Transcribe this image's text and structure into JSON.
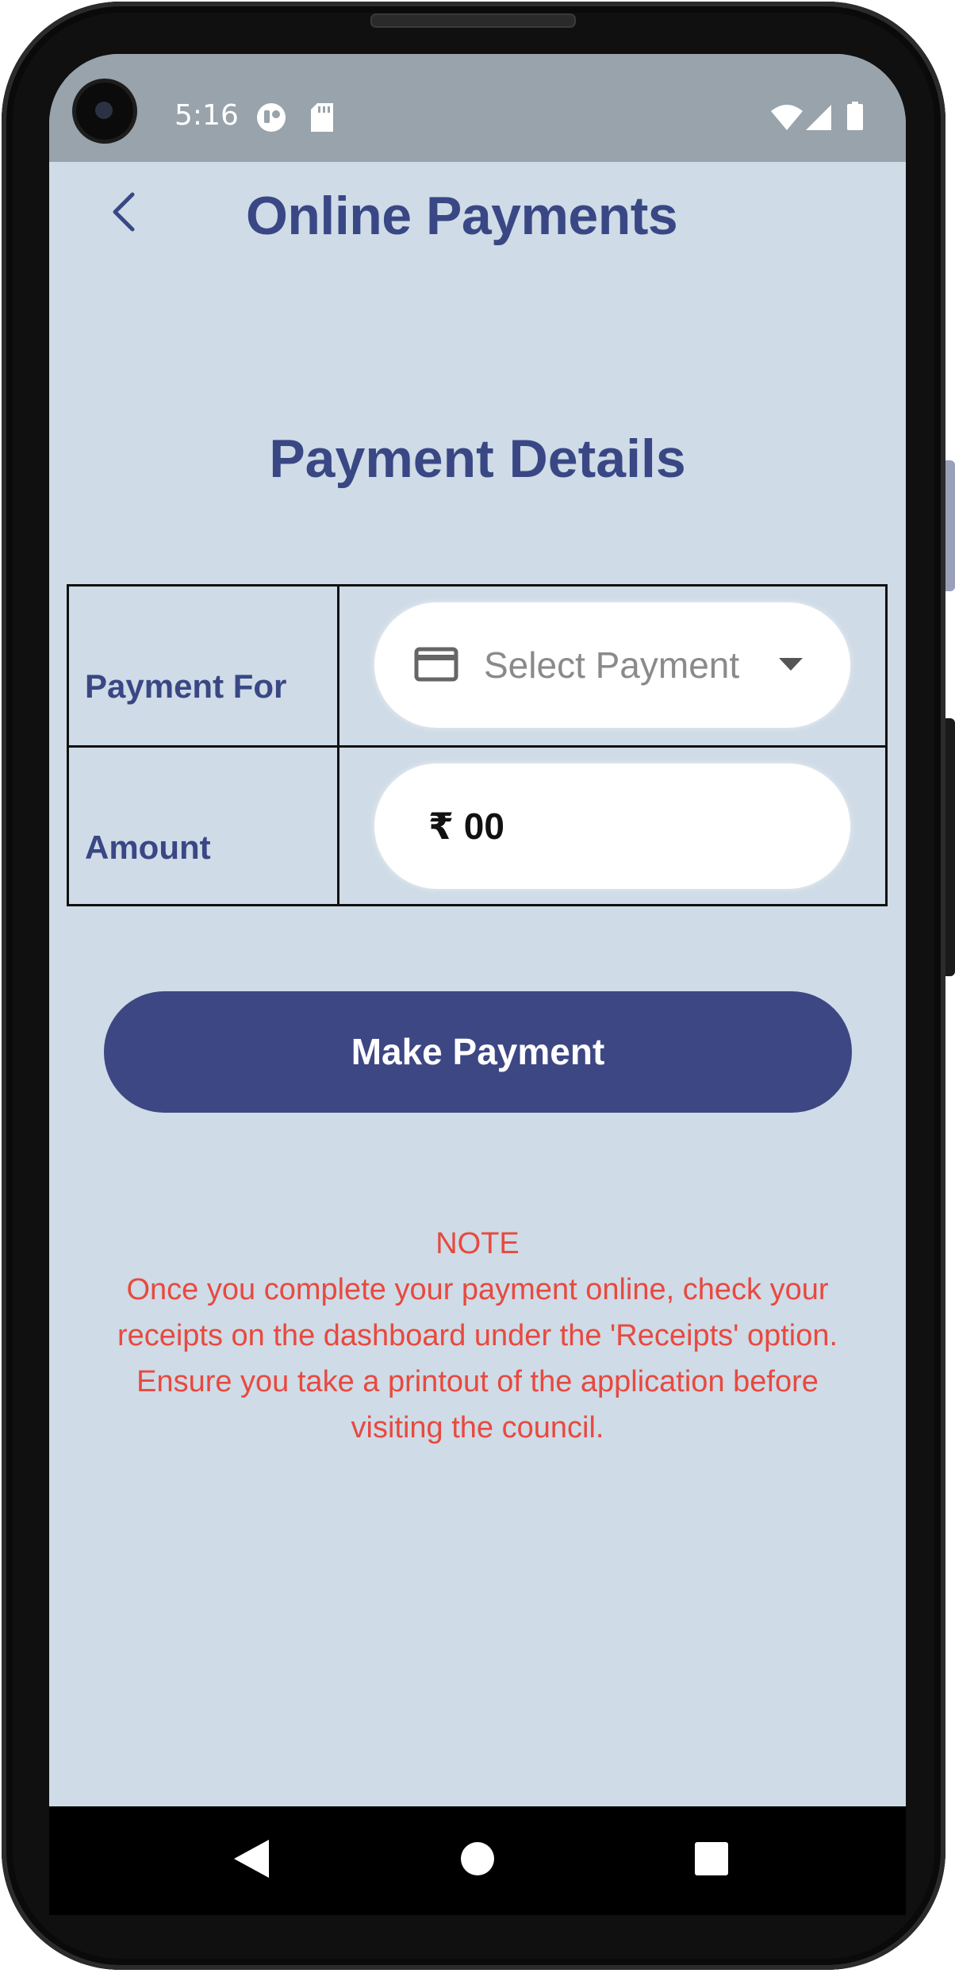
{
  "status_bar": {
    "time": "5:16",
    "icons": [
      "account-circle-icon",
      "sd-card-icon",
      "wifi-icon",
      "cellular-signal-icon",
      "battery-icon"
    ]
  },
  "header": {
    "back_icon": "chevron-left-icon",
    "title": "Online Payments"
  },
  "main": {
    "section_title": "Payment Details",
    "table": {
      "rows": [
        {
          "label": "Payment For",
          "field": {
            "type": "select",
            "icon": "credit-card-icon",
            "placeholder": "Select Payment",
            "dropdown_icon": "dropdown-arrow-icon"
          }
        },
        {
          "label": "Amount",
          "field": {
            "type": "input",
            "value": "₹ 00"
          }
        }
      ]
    },
    "make_payment_label": "Make Payment",
    "note": {
      "heading": "NOTE",
      "body": "Once you complete your payment online, check your receipts on the dashboard under the 'Receipts' option. Ensure you take a printout of the application before visiting the council."
    }
  },
  "nav_bar": {
    "icons": [
      "nav-back-icon",
      "nav-home-icon",
      "nav-recents-icon"
    ]
  },
  "colors": {
    "background": "#cfdbe6",
    "status_bar": "#98a3ab",
    "primary": "#3d4784",
    "title_text": "#3a4785",
    "note_text": "#e8493f",
    "placeholder_text": "#8a8a8a"
  }
}
